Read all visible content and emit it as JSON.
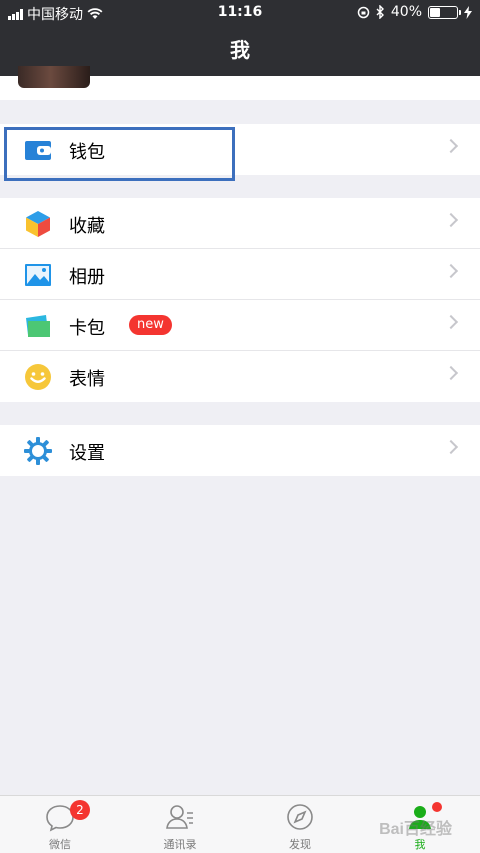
{
  "status_bar": {
    "carrier": "中国移动",
    "time": "11:16",
    "battery": "40%",
    "battery_level": 0.4
  },
  "header": {
    "title": "我"
  },
  "menu": {
    "wallet": {
      "label": "钱包",
      "icon": "wallet-icon"
    },
    "group2": [
      {
        "label": "收藏",
        "icon": "favorites-cube-icon"
      },
      {
        "label": "相册",
        "icon": "album-icon"
      },
      {
        "label": "卡包",
        "icon": "card-wallet-icon",
        "badge": "new"
      },
      {
        "label": "表情",
        "icon": "sticker-smiley-icon"
      }
    ],
    "settings": {
      "label": "设置",
      "icon": "settings-gear-icon"
    }
  },
  "tabbar": {
    "tabs": [
      {
        "label": "微信",
        "icon": "chats-icon",
        "badge": "2"
      },
      {
        "label": "通讯录",
        "icon": "contacts-icon"
      },
      {
        "label": "发现",
        "icon": "discover-compass-icon"
      },
      {
        "label": "我",
        "icon": "me-icon",
        "active": true
      }
    ]
  },
  "watermark": "Bai百经验",
  "colors": {
    "header_bg": "#2e2f33",
    "accent_green": "#1aad19",
    "badge_red": "#f43530",
    "highlight_blue": "#3c6fbd"
  }
}
